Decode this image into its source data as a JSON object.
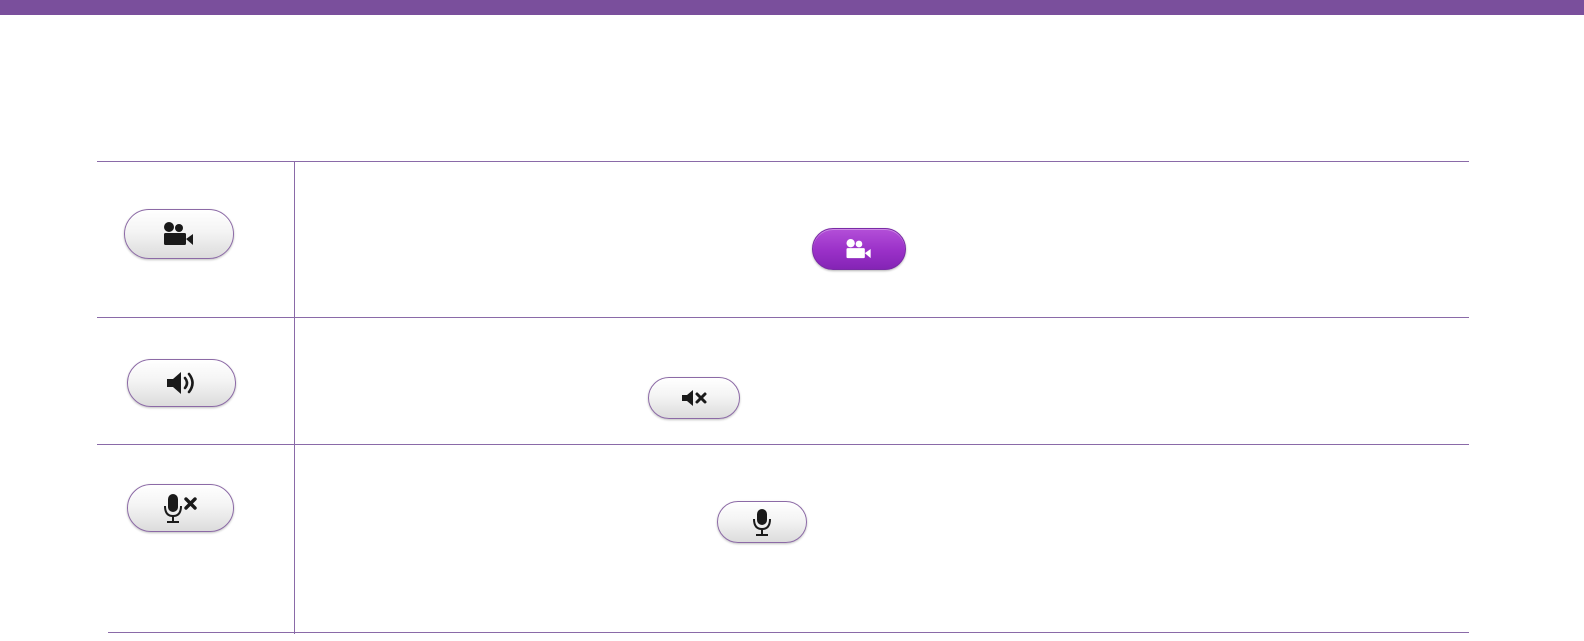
{
  "colors": {
    "header_bar": "#7a4f9c",
    "table_border": "#8a6aa8",
    "button_border": "#8c6aa6",
    "button_active": "#9a30c8",
    "icon": "#1a1a1a",
    "icon_active": "#ffffff"
  },
  "rows": [
    {
      "control": {
        "icon": "video-camera-icon",
        "state": "default"
      },
      "inline_state": {
        "icon": "video-camera-icon",
        "state": "active"
      }
    },
    {
      "control": {
        "icon": "speaker-volume-icon",
        "state": "default"
      },
      "inline_state": {
        "icon": "speaker-mute-icon",
        "state": "default"
      }
    },
    {
      "control": {
        "icon": "microphone-muted-icon",
        "state": "default"
      },
      "inline_state": {
        "icon": "microphone-icon",
        "state": "default"
      }
    }
  ]
}
